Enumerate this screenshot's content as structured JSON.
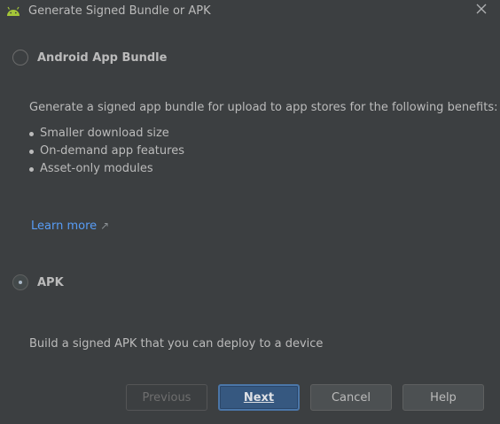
{
  "window": {
    "title": "Generate Signed Bundle or APK"
  },
  "options": {
    "bundle": {
      "label": "Android App Bundle",
      "selected": false,
      "description": "Generate a signed app bundle for upload to app stores for the following benefits:",
      "benefits": [
        "Smaller download size",
        "On-demand app features",
        "Asset-only modules"
      ],
      "learn_more": "Learn more"
    },
    "apk": {
      "label": "APK",
      "selected": true,
      "description": "Build a signed APK that you can deploy to a device"
    }
  },
  "buttons": {
    "previous": "Previous",
    "next": "Next",
    "cancel": "Cancel",
    "help": "Help"
  },
  "colors": {
    "background": "#3c3f41",
    "link": "#589df6",
    "primary_button": "#365880",
    "android_green": "#a4c639"
  },
  "icons": {
    "title": "android-icon",
    "close": "close-icon",
    "external_link": "external-link-arrow-icon"
  }
}
